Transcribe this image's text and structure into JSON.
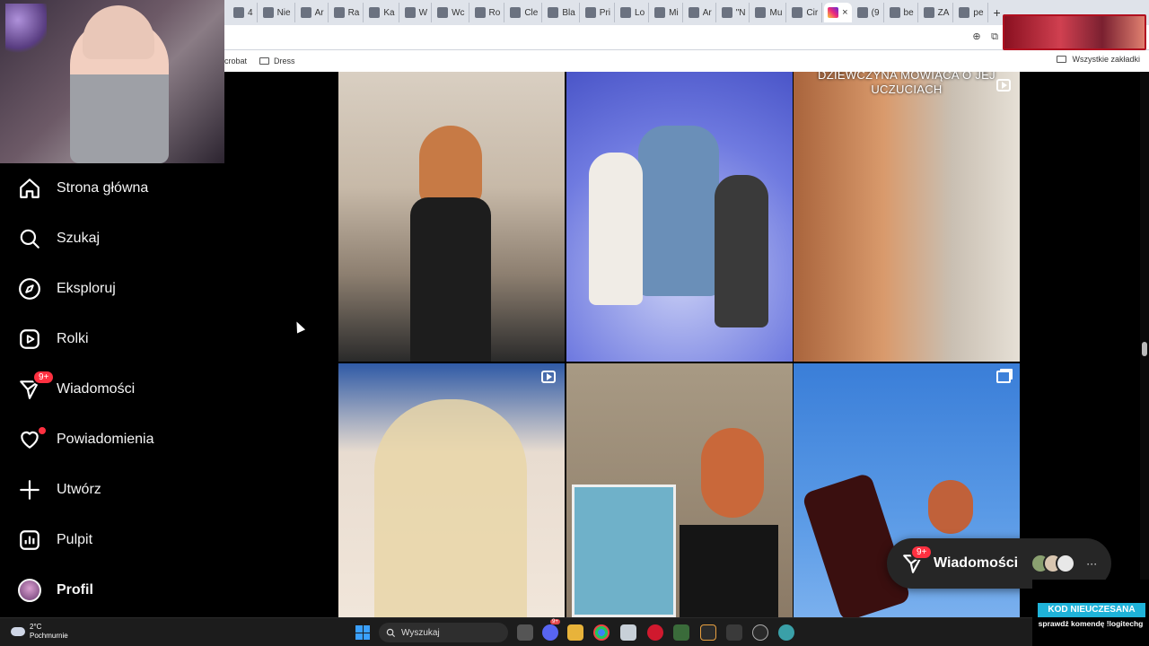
{
  "browser": {
    "tabs": [
      {
        "label": "4",
        "icon": "tab-icon"
      },
      {
        "label": "Nie",
        "icon": "kick-icon"
      },
      {
        "label": "Ar",
        "icon": "tab-icon"
      },
      {
        "label": "Ra",
        "icon": "notion-icon"
      },
      {
        "label": "Ka",
        "icon": "notion-icon"
      },
      {
        "label": "W",
        "icon": "wikipedia-icon"
      },
      {
        "label": "Wc",
        "icon": "tab-icon"
      },
      {
        "label": "Ro",
        "icon": "tab-icon"
      },
      {
        "label": "Cle",
        "icon": "tab-icon"
      },
      {
        "label": "Bla",
        "icon": "tab-icon"
      },
      {
        "label": "Pri",
        "icon": "tab-icon"
      },
      {
        "label": "Lo",
        "icon": "tab-icon"
      },
      {
        "label": "Mi",
        "icon": "tab-icon"
      },
      {
        "label": "Ar",
        "icon": "tab-icon"
      },
      {
        "label": "\"N",
        "icon": "tab-icon"
      },
      {
        "label": "Mu",
        "icon": "tab-icon"
      },
      {
        "label": "Cir",
        "icon": "tab-icon"
      }
    ],
    "active_tab_close": "×",
    "tabs_after": [
      {
        "label": "(9",
        "icon": "tiktok-icon"
      },
      {
        "label": "be",
        "icon": "google-icon"
      },
      {
        "label": "ZA",
        "icon": "tab-icon"
      },
      {
        "label": "pe",
        "icon": "google-icon"
      }
    ],
    "new_tab": "+",
    "bookmarks": [
      {
        "label": "crobat"
      },
      {
        "label": "Dress"
      }
    ],
    "all_bookmarks": "Wszystkie zakładki"
  },
  "sidebar": {
    "items": [
      {
        "label": "Strona główna",
        "icon": "home-icon"
      },
      {
        "label": "Szukaj",
        "icon": "search-icon"
      },
      {
        "label": "Eksploruj",
        "icon": "compass-icon"
      },
      {
        "label": "Rolki",
        "icon": "reels-icon"
      },
      {
        "label": "Wiadomości",
        "icon": "messenger-icon",
        "badge": "9+"
      },
      {
        "label": "Powiadomienia",
        "icon": "heart-icon"
      },
      {
        "label": "Utwórz",
        "icon": "plus-icon"
      },
      {
        "label": "Pulpit",
        "icon": "dashboard-icon"
      },
      {
        "label": "Profil",
        "icon": "profile-avatar"
      }
    ]
  },
  "posts": [
    {
      "type": "photo",
      "caption": ""
    },
    {
      "type": "photo",
      "caption": ""
    },
    {
      "type": "reel",
      "caption": "DZIEWCZYNA MÓWIĄCA O JEJ UCZUCIACH"
    },
    {
      "type": "reel",
      "caption": ""
    },
    {
      "type": "photo",
      "caption": ""
    },
    {
      "type": "carousel",
      "caption": ""
    }
  ],
  "messages_pill": {
    "label": "Wiadomości",
    "badge": "9+",
    "more": "···"
  },
  "promo": {
    "title": "KOD NIEUCZESANA",
    "subtitle": "sprawdź komendę !logitechg"
  },
  "taskbar": {
    "weather_temp": "2°C",
    "weather_desc": "Pochmurnie",
    "search_placeholder": "Wyszukaj",
    "discord_badge": "9+"
  }
}
